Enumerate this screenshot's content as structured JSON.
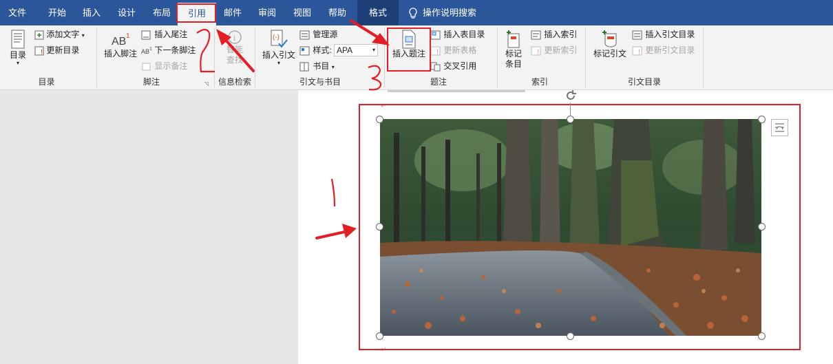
{
  "tabs": [
    "文件",
    "开始",
    "插入",
    "设计",
    "布局",
    "引用",
    "邮件",
    "审阅",
    "视图",
    "帮助",
    "格式"
  ],
  "active_tab": "引用",
  "tell_me": "操作说明搜索",
  "ribbon": {
    "toc": {
      "big": "目录",
      "add_text": "添加文字",
      "update_toc": "更新目录",
      "group": "目录"
    },
    "footnotes": {
      "big": "插入脚注",
      "insert_endnote": "插入尾注",
      "next_footnote": "下一条脚注",
      "show_notes": "显示备注",
      "group": "脚注"
    },
    "research": {
      "big": "智能\n查找",
      "big_line1": "智能",
      "big_line2": "查找",
      "group": "信息检索"
    },
    "citations": {
      "big": "插入引文",
      "manage_sources": "管理源",
      "style_label": "样式:",
      "style_value": "APA",
      "bibliography": "书目",
      "group": "引文与书目"
    },
    "captions": {
      "big": "插入题注",
      "insert_table_of_figures": "插入表目录",
      "update_table": "更新表格",
      "cross_reference": "交叉引用",
      "group": "题注"
    },
    "index": {
      "big_line1": "标记",
      "big_line2": "条目",
      "insert_index": "插入索引",
      "update_index": "更新索引",
      "group": "索引"
    },
    "toa": {
      "big": "标记引文",
      "insert_toa": "插入引文目录",
      "update_toa": "更新引文目录",
      "group": "引文目录"
    }
  },
  "annotations": {
    "step2": "2",
    "step3": "3",
    "step1": "1"
  },
  "colors": {
    "title_bar": "#2b579a",
    "annotation_red": "#e41e26"
  }
}
